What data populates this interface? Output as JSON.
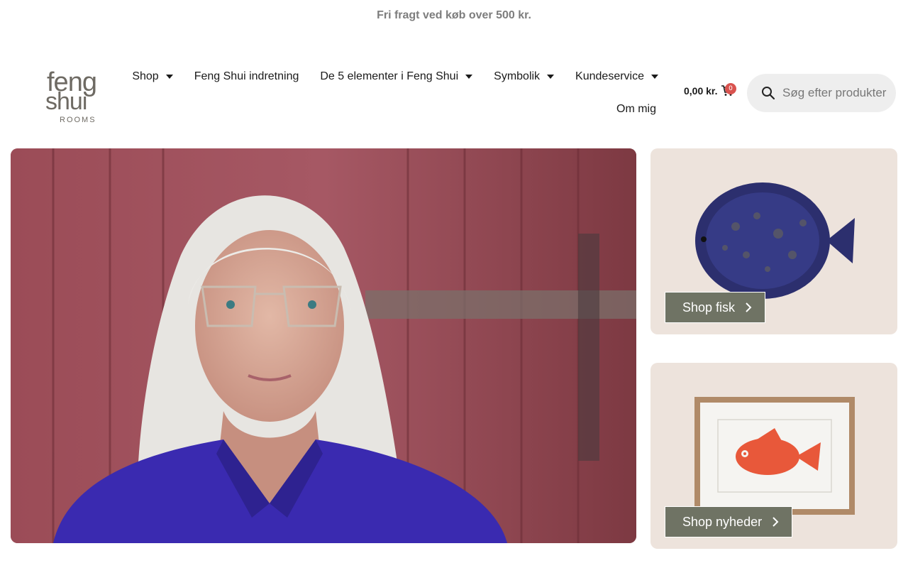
{
  "announcement": "Fri fragt ved køb over 500 kr.",
  "brand": {
    "logo_line1": "feng",
    "logo_line2": "shui",
    "logo_line3": "ROOMS"
  },
  "nav": {
    "items": [
      {
        "label": "Shop",
        "has_dropdown": true
      },
      {
        "label": "Feng Shui indretning",
        "has_dropdown": false
      },
      {
        "label": "De 5 elementer i Feng Shui",
        "has_dropdown": true
      },
      {
        "label": "Symbolik",
        "has_dropdown": true
      },
      {
        "label": "Kundeservice",
        "has_dropdown": true
      },
      {
        "label": "Om mig",
        "has_dropdown": false
      }
    ]
  },
  "cart": {
    "total": "0,00 kr.",
    "count": "0"
  },
  "search": {
    "placeholder": "Søg efter produkter"
  },
  "promos": [
    {
      "button_label": "Shop fisk",
      "icon": "flatfish-image"
    },
    {
      "button_label": "Shop nyheder",
      "icon": "framed-fish-print-image"
    }
  ],
  "colors": {
    "announcement_text": "#7d7d7d",
    "button_bg": "#6f7364",
    "promo_bg": "#ede3dc",
    "cart_badge": "#d9534f",
    "search_bg": "#eeeeee"
  }
}
